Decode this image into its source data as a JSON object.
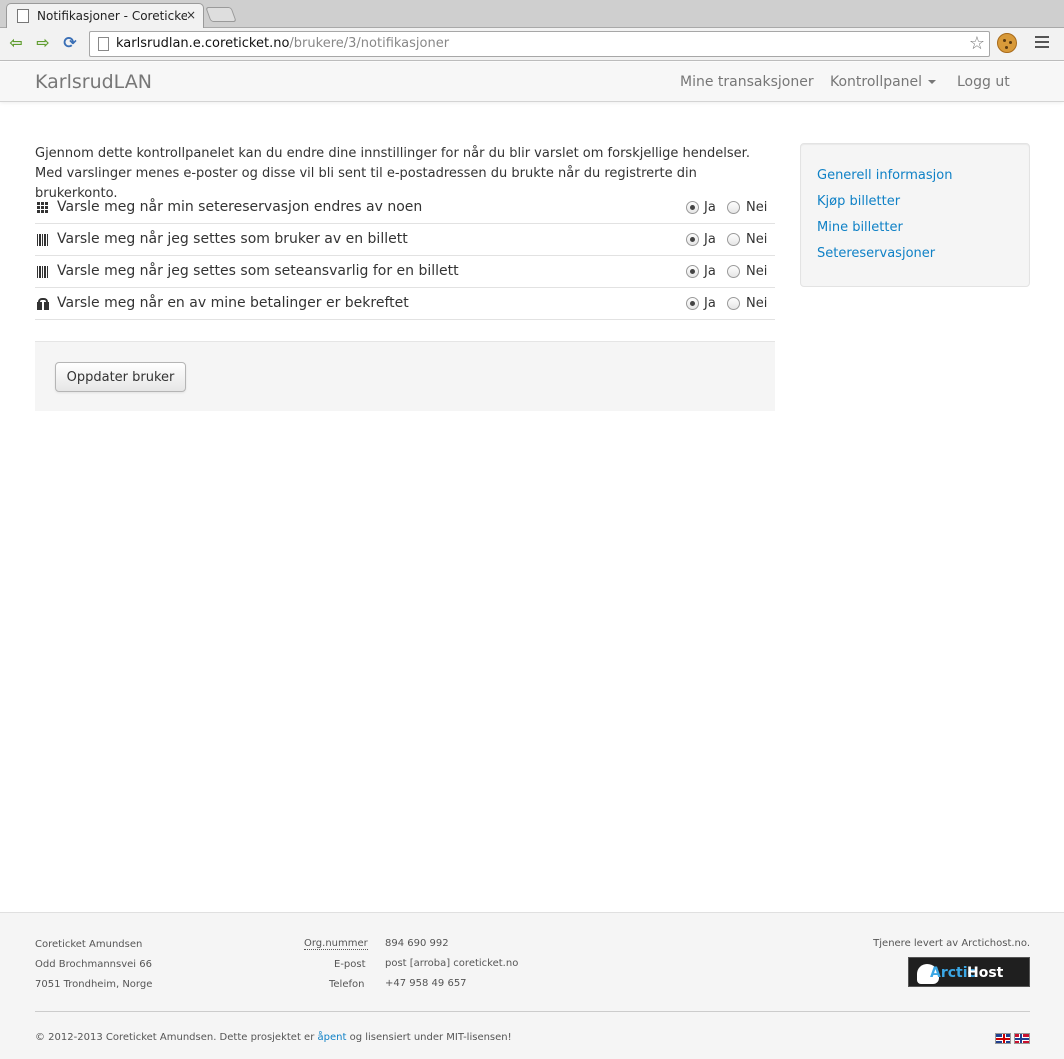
{
  "browser": {
    "tab_title": "Notifikasjoner - Coreticket",
    "tab_close": "×",
    "url_host": "karlsrudlan.e.coreticket.no",
    "url_path": "/brukere/3/notifikasjoner",
    "star": "☆",
    "back": "⇦",
    "forward": "⇨",
    "reload": "⟳"
  },
  "navbar": {
    "brand": "KarlsrudLAN",
    "links": [
      "Mine transaksjoner",
      "Kontrollpanel",
      "Logg ut"
    ]
  },
  "intro": "Gjennom dette kontrollpanelet kan du endre dine innstillinger for når du blir varslet om forskjellige hendelser. Med varslinger menes e-poster og disse vil bli sent til e-postadressen du brukte når du registrerte din brukerkonto.",
  "notifications": [
    {
      "label": "Varsle meg når min setereservasjon endres av noen",
      "icon": "grid-icon",
      "selected": "Ja"
    },
    {
      "label": "Varsle meg når jeg settes som bruker av en billett",
      "icon": "barcode-icon",
      "selected": "Ja"
    },
    {
      "label": "Varsle meg når jeg settes som seteansvarlig for en billett",
      "icon": "barcode-icon",
      "selected": "Ja"
    },
    {
      "label": "Varsle meg når en av mine betalinger er bekreftet",
      "icon": "gift-icon",
      "selected": "Ja"
    }
  ],
  "options": {
    "yes": "Ja",
    "no": "Nei"
  },
  "update_button": "Oppdater bruker",
  "sidebar": {
    "links": [
      "Generell informasjon",
      "Kjøp billetter",
      "Mine billetter",
      "Setereservasjoner"
    ]
  },
  "footer": {
    "company": "Coreticket Amundsen",
    "street": "Odd Brochmannsvei 66",
    "city": "7051 Trondheim, Norge",
    "org_label": "Org.nummer",
    "org_value": "894 690 992",
    "email_label": "E-post",
    "email_value": "post [arroba] coreticket.no",
    "phone_label": "Telefon",
    "phone_value": "+47 958 49 657",
    "hosting_text": "Tjenere levert av Arctichost.no.",
    "logo_arctic": "Arctic",
    "logo_host": "Host",
    "copyright_pre": "© 2012-2013 Coreticket Amundsen. Dette prosjektet er",
    "copyright_link": "åpent",
    "copyright_post": "og lisensiert under MIT-lisensen!"
  },
  "colors": {
    "link": "#0f81c6",
    "navbar_bg": "#f7f7f7",
    "well_bg": "#f5f5f5"
  }
}
